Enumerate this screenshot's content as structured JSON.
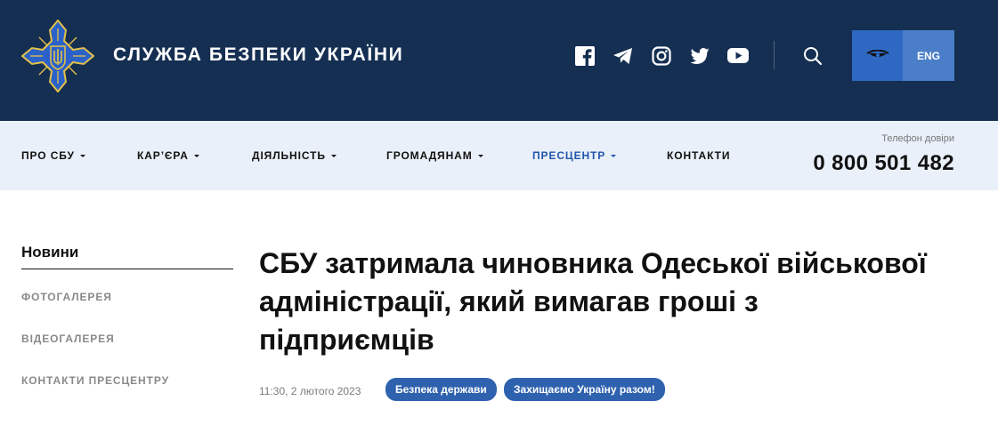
{
  "header": {
    "logo_name": "sbu-emblem",
    "site_title": "СЛУЖБА БЕЗПЕКИ УКРАЇНИ",
    "social_icons": [
      "facebook-icon",
      "telegram-icon",
      "instagram-icon",
      "twitter-icon",
      "youtube-icon"
    ],
    "accessibility_icon": "eye-icon",
    "language": "ENG"
  },
  "nav": {
    "items": [
      {
        "label": "ПРО СБУ"
      },
      {
        "label": "КАР’ЄРА"
      },
      {
        "label": "ДІЯЛЬНІСТЬ"
      },
      {
        "label": "ГРОМАДЯНАМ"
      },
      {
        "label": "ПРЕСЦЕНТР"
      },
      {
        "label": "КОНТАКТИ"
      }
    ],
    "hotline_label": "Телефон довіри",
    "hotline_phone": "0 800 501 482"
  },
  "sidebar": {
    "title": "Новини",
    "items": [
      {
        "label": "ФОТОГАЛЕРЕЯ"
      },
      {
        "label": "ВІДЕОГАЛЕРЕЯ"
      },
      {
        "label": "КОНТАКТИ ПРЕСЦЕНТРУ"
      }
    ]
  },
  "article": {
    "headline": "СБУ затримала чиновника Одеської військової адміністрації, який вимагав гроші з підприємців",
    "datetime": "11:30, 2 лютого 2023",
    "tags": [
      "Безпека держави",
      "Захищаємо Україну разом!"
    ]
  },
  "colors": {
    "header_bg": "#152f52",
    "nav_bg": "#eaf0f9",
    "accent": "#2056ab",
    "tag_bg": "#2f62ae",
    "emblem_blue": "#2a62c9",
    "emblem_gold": "#e4c14a"
  }
}
